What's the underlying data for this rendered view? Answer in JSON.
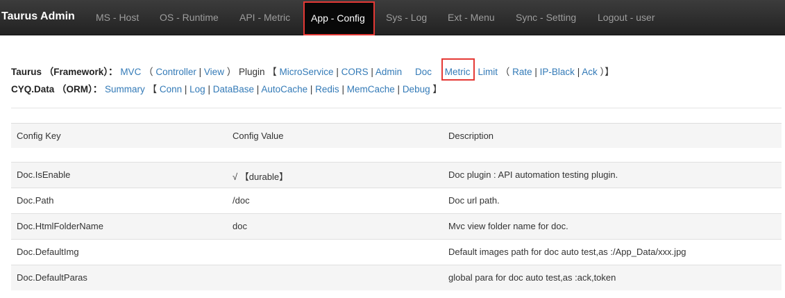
{
  "navbar": {
    "brand": "Taurus Admin",
    "items": [
      {
        "label": "MS - Host"
      },
      {
        "label": "OS - Runtime"
      },
      {
        "label": "API - Metric"
      },
      {
        "label": "App - Config",
        "active": true
      },
      {
        "label": "Sys - Log"
      },
      {
        "label": "Ext - Menu"
      },
      {
        "label": "Sync - Setting"
      },
      {
        "label": "Logout - user"
      }
    ]
  },
  "links": {
    "taurus_key": "Taurus （Framework）：",
    "mvc": "MVC",
    "open_paren": "（",
    "controller": "Controller",
    "view": "View",
    "close_paren": "）",
    "plugin_label": "Plugin",
    "open_bracket": "【",
    "microservice": "MicroService",
    "cors": "CORS",
    "admin": "Admin",
    "doc": "Doc",
    "metric": "Metric",
    "limit": "Limit",
    "rate": "Rate",
    "ip_black": "IP-Black",
    "ack": "Ack",
    "close_mixed": "）】",
    "cyq_key": "CYQ.Data （ORM）：",
    "summary": "Summary",
    "conn": "Conn",
    "log": "Log",
    "database": "DataBase",
    "autocache": "AutoCache",
    "redis": "Redis",
    "memcache": "MemCache",
    "debug": "Debug",
    "close_bracket": "】",
    "sep": "|"
  },
  "table": {
    "headers": [
      "Config Key",
      "Config Value",
      "Description"
    ],
    "rows": [
      {
        "key": "Doc.IsEnable",
        "value": "√ 【durable】",
        "description": "Doc plugin : API automation testing plugin."
      },
      {
        "key": "Doc.Path",
        "value": "/doc",
        "description": "Doc url path."
      },
      {
        "key": "Doc.HtmlFolderName",
        "value": "doc",
        "description": "Mvc view folder name for doc."
      },
      {
        "key": "Doc.DefaultImg",
        "value": "",
        "description": "Default images path for doc auto test,as :/App_Data/xxx.jpg"
      },
      {
        "key": "Doc.DefaultParas",
        "value": "",
        "description": "global para for doc auto test,as :ack,token"
      }
    ]
  },
  "colors": {
    "navbar_bg": "#222222",
    "link": "#337ab7",
    "highlight": "#e53935"
  }
}
